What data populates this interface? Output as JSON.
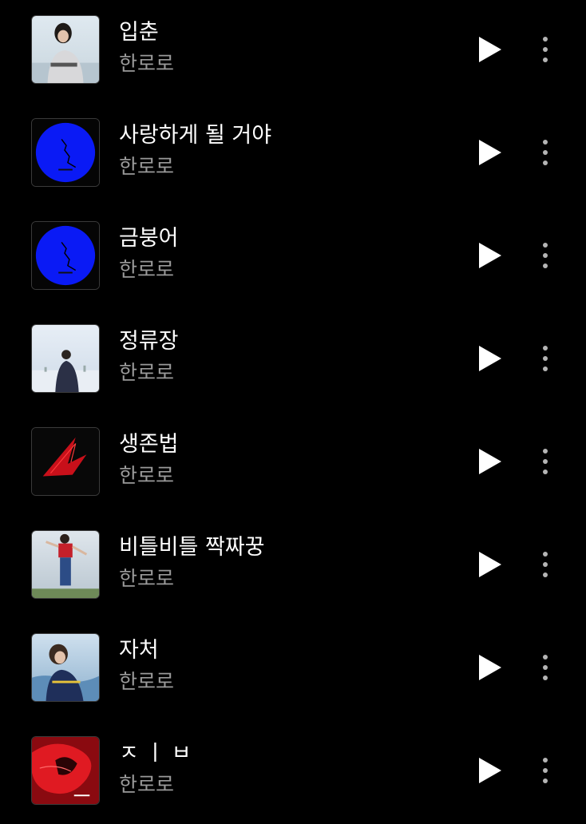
{
  "colors": {
    "background": "#000000",
    "title_text": "#ffffff",
    "artist_text": "#9a9a9a",
    "icon": "#ffffff",
    "more_icon": "#b5b5b5"
  },
  "icons": {
    "play": "play-icon",
    "more": "more-vertical-icon"
  },
  "songs": [
    {
      "title": "입춘",
      "artist": "한로로",
      "art": "girl-by-sea-photo"
    },
    {
      "title": "사랑하게 될 거야",
      "artist": "한로로",
      "art": "blue-circle-cover"
    },
    {
      "title": "금붕어",
      "artist": "한로로",
      "art": "blue-circle-cover"
    },
    {
      "title": "정류장",
      "artist": "한로로",
      "art": "snow-field-photo"
    },
    {
      "title": "생존법",
      "artist": "한로로",
      "art": "red-burst-on-black-cover"
    },
    {
      "title": "비틀비틀 짝짜꿍",
      "artist": "한로로",
      "art": "girl-jumping-photo"
    },
    {
      "title": "자처",
      "artist": "한로로",
      "art": "girl-in-water-photo"
    },
    {
      "title": "ㅈㅣㅂ",
      "artist": "한로로",
      "art": "red-flower-cover"
    }
  ]
}
